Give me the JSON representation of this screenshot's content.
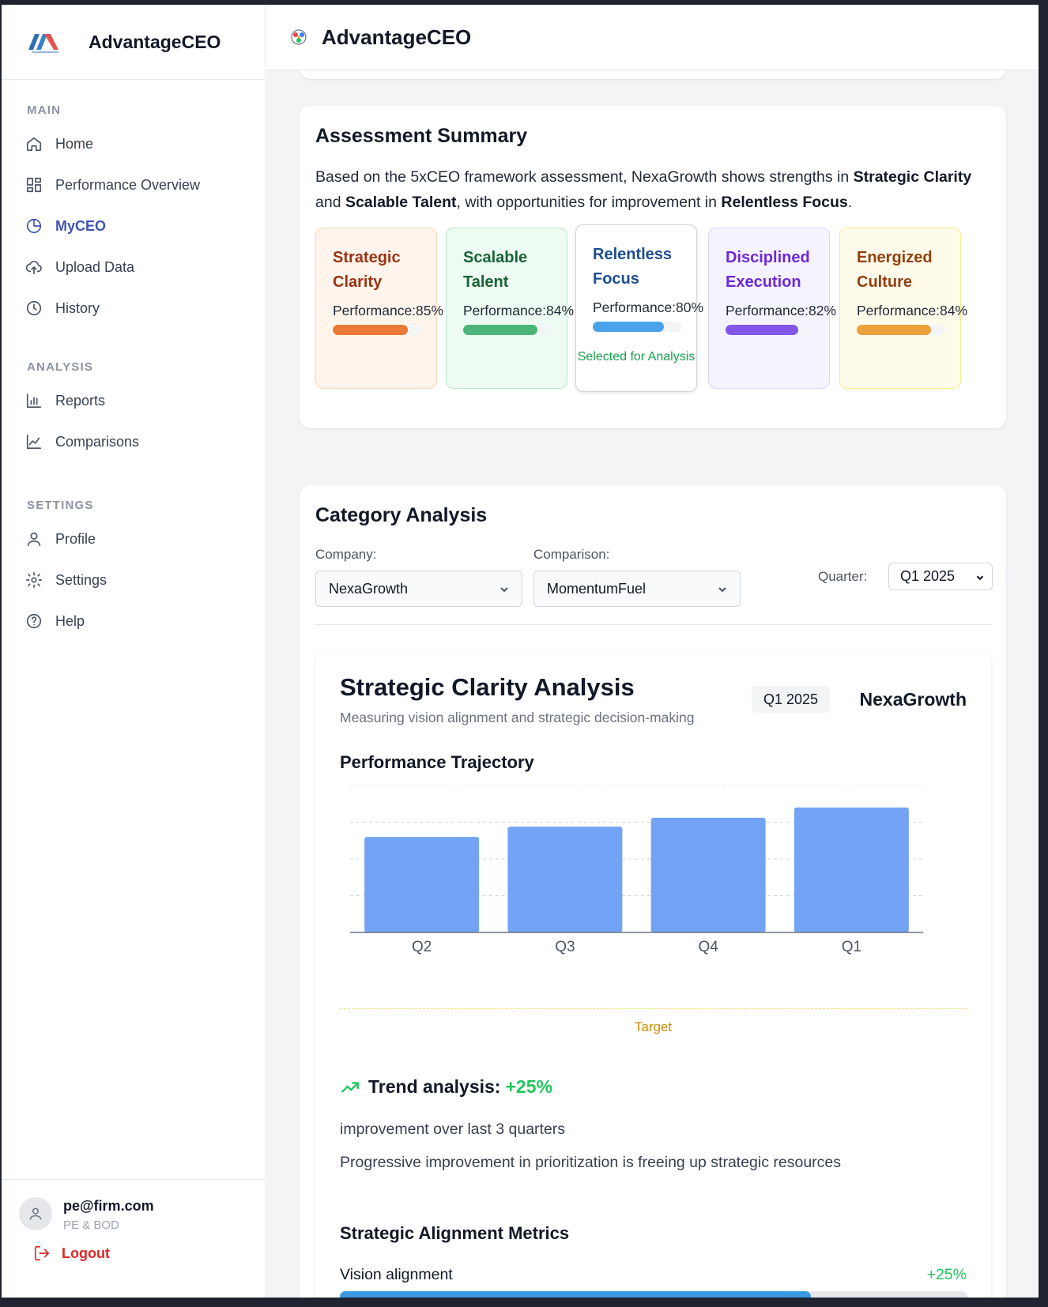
{
  "app": {
    "brand": "AdvantageCEO",
    "header_title": "AdvantageCEO"
  },
  "sidebar": {
    "sections": [
      {
        "label": "MAIN",
        "items": [
          {
            "label": "Home",
            "icon": "home-icon"
          },
          {
            "label": "Performance Overview",
            "icon": "dashboard-icon"
          },
          {
            "label": "MyCEO",
            "icon": "pie-chart-icon",
            "active": true
          },
          {
            "label": "Upload Data",
            "icon": "cloud-upload-icon"
          },
          {
            "label": "History",
            "icon": "clock-icon"
          }
        ]
      },
      {
        "label": "ANALYSIS",
        "items": [
          {
            "label": "Reports",
            "icon": "bar-chart-icon"
          },
          {
            "label": "Comparisons",
            "icon": "line-chart-icon"
          }
        ]
      },
      {
        "label": "SETTINGS",
        "items": [
          {
            "label": "Profile",
            "icon": "user-icon"
          },
          {
            "label": "Settings",
            "icon": "gear-icon"
          },
          {
            "label": "Help",
            "icon": "help-icon"
          }
        ]
      }
    ],
    "user": {
      "email": "pe@firm.com",
      "role": "PE & BOD",
      "logout_label": "Logout"
    }
  },
  "summary": {
    "title": "Assessment Summary",
    "text_parts": [
      "Based on the 5xCEO framework assessment, NexaGrowth shows strengths in ",
      "Strategic Clarity",
      " and ",
      "Scalable Talent",
      ", with opportunities for improvement in ",
      "Relentless Focus",
      "."
    ],
    "pillars": [
      {
        "name": "Strategic Clarity",
        "perf_label": "Performance:85%",
        "value": 0.85,
        "color": "#ea7a35",
        "text_color": "#9a3412",
        "bg": "#fff5ed",
        "border": "#fbd5b5"
      },
      {
        "name": "Scalable Talent",
        "perf_label": "Performance:84%",
        "value": 0.84,
        "color": "#4cb67a",
        "text_color": "#166534",
        "bg": "#edfbf3",
        "border": "#b7ecd0"
      },
      {
        "name": "Relentless Focus",
        "perf_label": "Performance:80%",
        "value": 0.8,
        "color": "#4aa3ea",
        "text_color": "#1e4e8c",
        "bg": "#ffffff",
        "border": "#d1d5db",
        "selected_label": "Selected for Analysis"
      },
      {
        "name": "Disciplined Execution",
        "perf_label": "Performance:82%",
        "value": 0.82,
        "color": "#8356e8",
        "text_color": "#6d28d9",
        "bg": "#f5f3ff",
        "border": "#ddd6fe"
      },
      {
        "name": "Energized Culture",
        "perf_label": "Performance:84%",
        "value": 0.84,
        "color": "#eba13a",
        "text_color": "#92400e",
        "bg": "#fffbeb",
        "border": "#fde68a"
      }
    ]
  },
  "category": {
    "title": "Category Analysis",
    "company_label": "Company:",
    "company_value": "NexaGrowth",
    "comparison_label": "Comparison:",
    "comparison_value": "MomentumFuel",
    "quarter_label": "Quarter:",
    "quarter_value": "Q1 2025"
  },
  "analysis": {
    "title": "Strategic Clarity Analysis",
    "subtitle": "Measuring vision alignment and strategic decision-making",
    "quarter_badge": "Q1 2025",
    "company": "NexaGrowth",
    "chart_heading": "Performance Trajectory",
    "target_label": "Target",
    "trend_label": "Trend analysis:",
    "trend_value": "+25%",
    "trend_line1": "improvement over last 3 quarters",
    "trend_line2": "Progressive improvement in prioritization is freeing up strategic resources",
    "metrics_heading": "Strategic Alignment Metrics",
    "metrics": [
      {
        "name": "Vision alignment",
        "delta": "+25%",
        "fill": 0.75
      }
    ]
  },
  "chart_data": {
    "type": "bar",
    "title": "Performance Trajectory",
    "categories": [
      "Q2",
      "Q3",
      "Q4",
      "Q1"
    ],
    "values": [
      65,
      72,
      78,
      85
    ],
    "ylim": [
      0,
      100
    ],
    "grid": true,
    "color": "#72a3f4"
  }
}
